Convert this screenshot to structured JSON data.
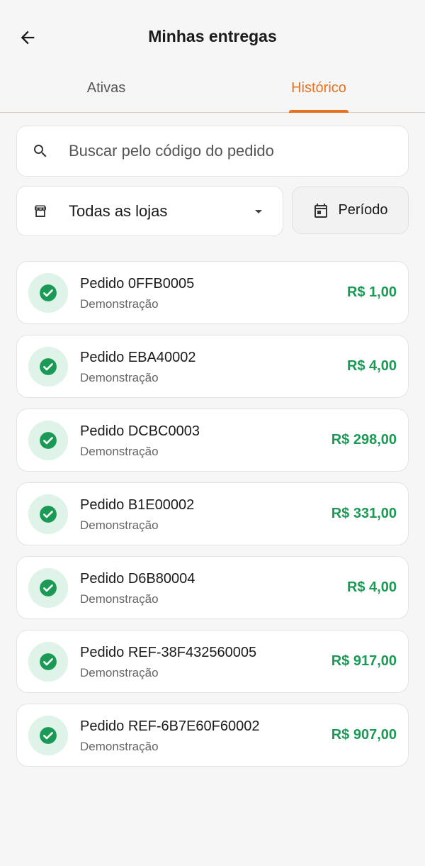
{
  "header": {
    "title": "Minhas entregas"
  },
  "tabs": [
    {
      "label": "Ativas",
      "active": false
    },
    {
      "label": "Histórico",
      "active": true
    }
  ],
  "search": {
    "placeholder": "Buscar pelo código do pedido",
    "value": ""
  },
  "filters": {
    "store_label": "Todas as lojas",
    "period_label": "Período"
  },
  "colors": {
    "accent": "#e8711d",
    "success": "#1a9a55",
    "success_bg": "#dff3e8"
  },
  "orders": [
    {
      "name": "Pedido 0FFB0005",
      "subtitle": "Demonstração",
      "price": "R$ 1,00"
    },
    {
      "name": "Pedido EBA40002",
      "subtitle": "Demonstração",
      "price": "R$ 4,00"
    },
    {
      "name": "Pedido DCBC0003",
      "subtitle": "Demonstração",
      "price": "R$ 298,00"
    },
    {
      "name": "Pedido B1E00002",
      "subtitle": "Demonstração",
      "price": "R$ 331,00"
    },
    {
      "name": "Pedido D6B80004",
      "subtitle": "Demonstração",
      "price": "R$ 4,00"
    },
    {
      "name": "Pedido REF-38F432560005",
      "subtitle": "Demonstração",
      "price": "R$ 917,00"
    },
    {
      "name": "Pedido REF-6B7E60F60002",
      "subtitle": "Demonstração",
      "price": "R$ 907,00"
    }
  ]
}
